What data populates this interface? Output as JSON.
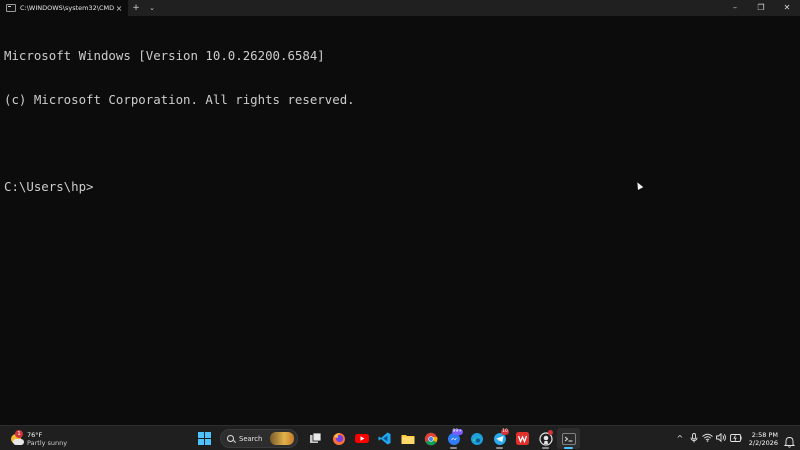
{
  "window": {
    "tab_title": "C:\\WINDOWS\\system32\\CMD",
    "tab_close": "×",
    "new_tab": "+",
    "dropdown": "⌄",
    "minimize": "–",
    "maximize": "❐",
    "close": "✕"
  },
  "console": {
    "lines": [
      "Microsoft Windows [Version 10.0.26200.6584]",
      "(c) Microsoft Corporation. All rights reserved.",
      "",
      "C:\\Users\\hp>"
    ]
  },
  "taskbar": {
    "weather": {
      "temp": "76°F",
      "condition": "Partly sunny",
      "badge": "1"
    },
    "search": {
      "label": "Search"
    },
    "apps": [
      {
        "name": "start",
        "icon": "windows-start-icon"
      },
      {
        "name": "task-view",
        "icon": "task-view-icon"
      },
      {
        "name": "firefox",
        "icon": "firefox-icon"
      },
      {
        "name": "youtube",
        "icon": "youtube-icon"
      },
      {
        "name": "vscode",
        "icon": "vscode-icon"
      },
      {
        "name": "file-explorer",
        "icon": "folder-icon"
      },
      {
        "name": "chrome",
        "icon": "chrome-icon"
      },
      {
        "name": "messenger",
        "icon": "messenger-icon",
        "badge": "99+"
      },
      {
        "name": "edge",
        "icon": "edge-icon"
      },
      {
        "name": "telegram",
        "icon": "telegram-icon",
        "badge": "10"
      },
      {
        "name": "wps-office",
        "icon": "wps-icon"
      },
      {
        "name": "github-desktop",
        "icon": "github-icon"
      },
      {
        "name": "terminal",
        "icon": "terminal-icon"
      }
    ],
    "tray": {
      "chevron": "^",
      "time": "2:58 PM",
      "date": "2/2/2026"
    }
  },
  "colors": {
    "console_bg": "#0c0c0c",
    "console_text": "#cccccc",
    "titlebar_bg": "#202020",
    "taskbar_bg": "#1f1f1f",
    "accent": "#4cc2ff"
  }
}
